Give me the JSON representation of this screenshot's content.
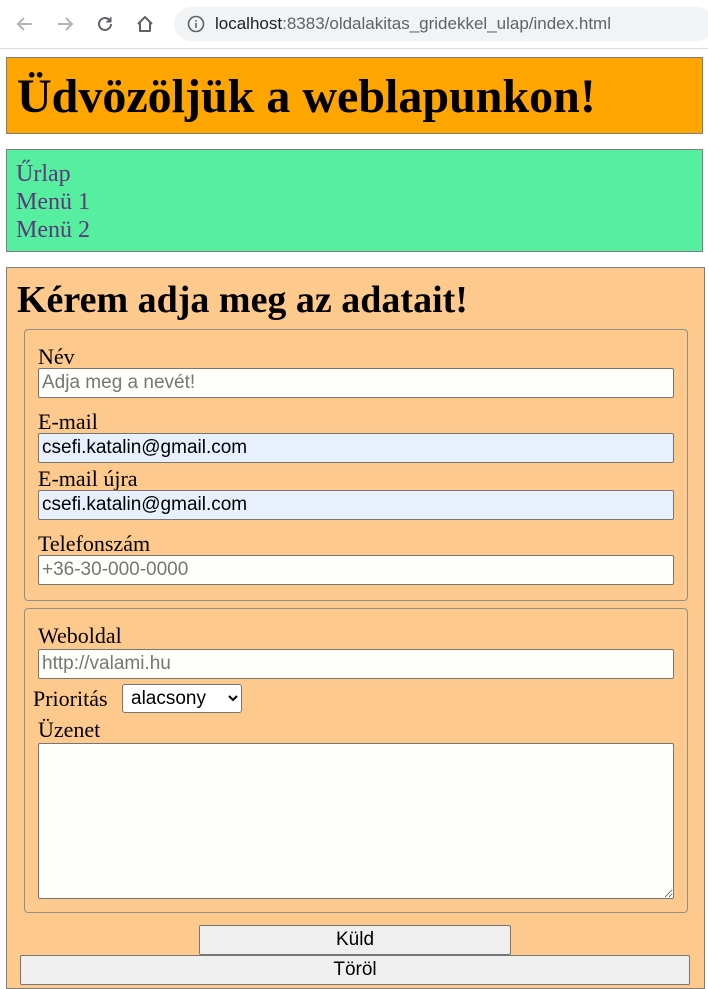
{
  "browser": {
    "url_host": "localhost",
    "url_path": ":8383/oldalakitas_gridekkel_ulap/index.html"
  },
  "header": {
    "title": "Üdvözöljük a weblapunkon!"
  },
  "nav": {
    "items": [
      "Űrlap",
      "Menü 1",
      "Menü 2"
    ]
  },
  "main": {
    "heading": "Kérem adja meg az adatait!",
    "fields": {
      "name": {
        "label": "Név",
        "placeholder": "Adja meg a nevét!",
        "value": ""
      },
      "email": {
        "label": "E-mail",
        "value": "csefi.katalin@gmail.com"
      },
      "email_again": {
        "label": "E-mail újra",
        "value": "csefi.katalin@gmail.com"
      },
      "phone": {
        "label": "Telefonszám",
        "placeholder": "+36-30-000-0000",
        "value": ""
      },
      "website": {
        "label": "Weboldal",
        "placeholder": "http://valami.hu",
        "value": ""
      },
      "priority": {
        "label": "Prioritás",
        "selected": "alacsony"
      },
      "message": {
        "label": "Üzenet",
        "value": ""
      }
    },
    "buttons": {
      "send": "Küld",
      "clear": "Töröl"
    }
  },
  "colors": {
    "header_bg": "#ffa500",
    "nav_bg": "#56ee9f",
    "main_bg": "#fec98d",
    "nav_link": "#5a3b7a",
    "autofill_bg": "#e8f0fe"
  }
}
